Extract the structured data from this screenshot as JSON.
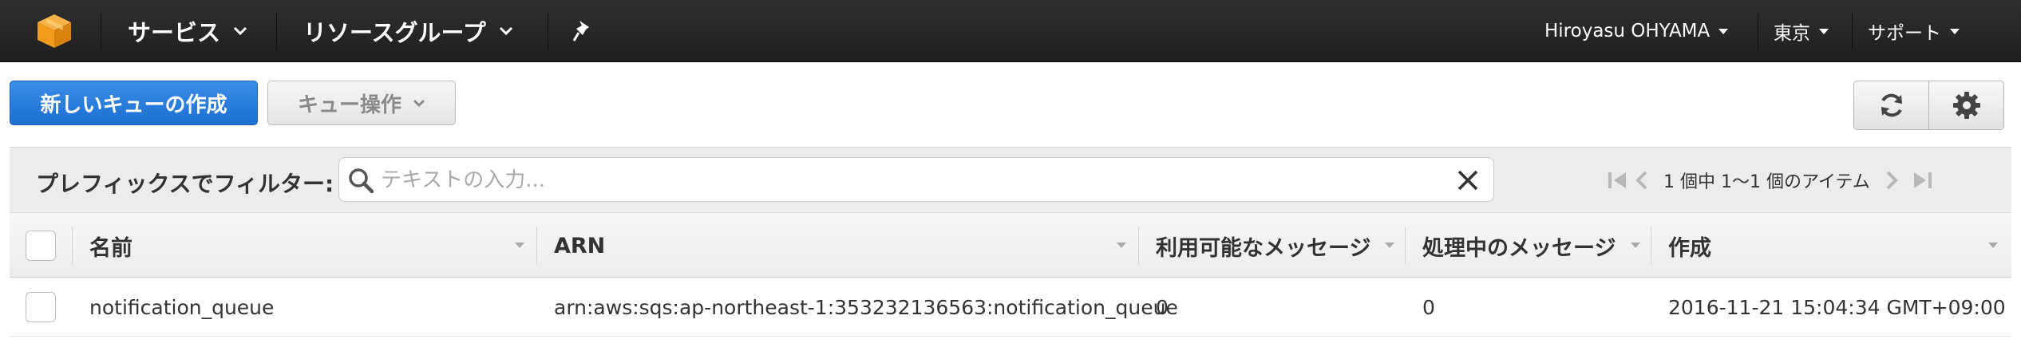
{
  "nav": {
    "services": "サービス",
    "resource_groups": "リソースグループ",
    "user": "Hiroyasu OHYAMA",
    "region": "東京",
    "support": "サポート"
  },
  "toolbar": {
    "create_queue": "新しいキューの作成",
    "queue_actions": "キュー操作"
  },
  "filter": {
    "label": "プレフィックスでフィルター:",
    "placeholder": "テキストの入力...",
    "value": "",
    "pagination": "1 個中 1～1 個のアイテム"
  },
  "table": {
    "columns": [
      "名前",
      "ARN",
      "利用可能なメッセージ",
      "処理中のメッセージ",
      "作成"
    ],
    "rows": [
      {
        "name": "notification_queue",
        "arn": "arn:aws:sqs:ap-northeast-1:353232136563:notification_queue",
        "available": "0",
        "in_flight": "0",
        "created": "2016-11-21 15:04:34 GMT+09:00"
      }
    ]
  },
  "colors": {
    "topbar": "#232323",
    "primary_button": "#1f72d4",
    "logo": "#f29b1d"
  }
}
